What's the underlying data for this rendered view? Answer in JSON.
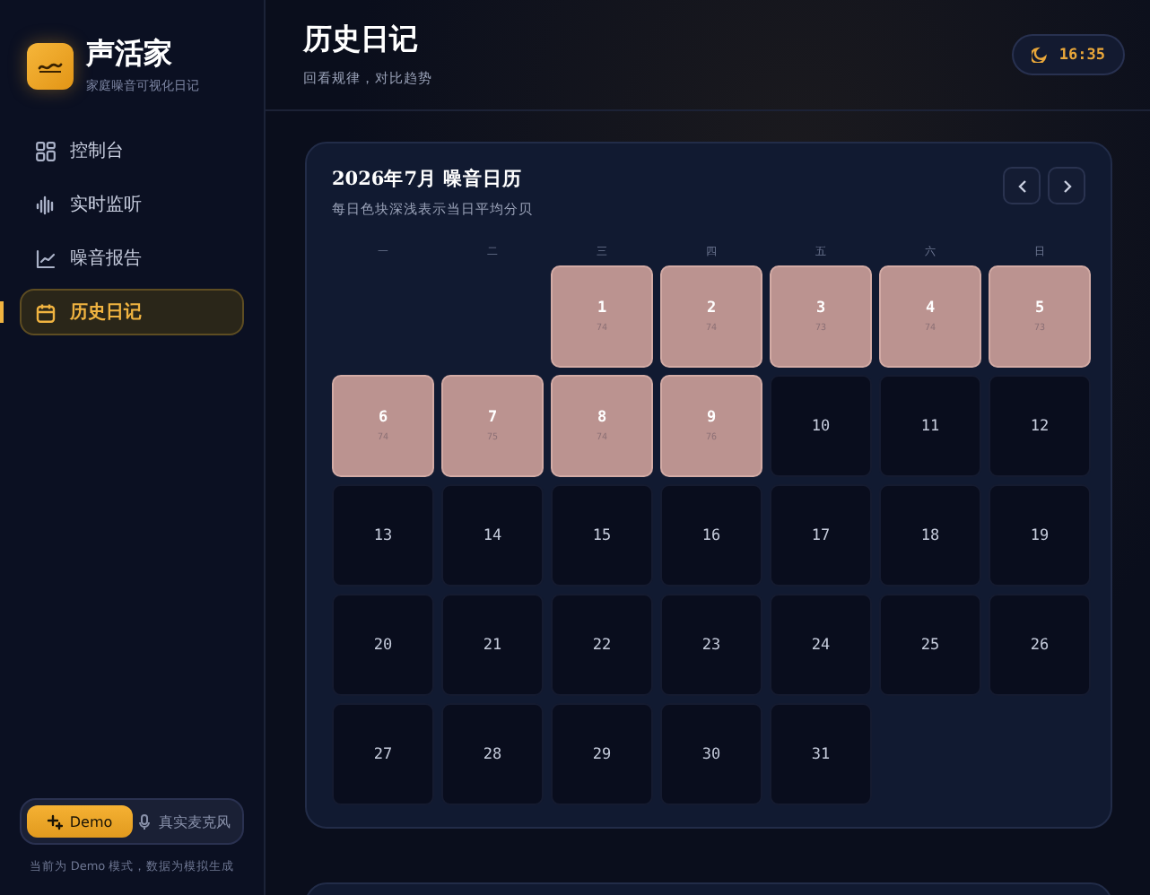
{
  "app": {
    "name": "声活家",
    "tagline": "家庭噪音可视化日记"
  },
  "nav": [
    {
      "label": "控制台",
      "selected": false
    },
    {
      "label": "实时监听",
      "selected": false
    },
    {
      "label": "噪音报告",
      "selected": false
    },
    {
      "label": "历史日记",
      "selected": true
    }
  ],
  "mode_switch": [
    {
      "label": "Demo",
      "selected": true
    },
    {
      "label": "真实麦克风",
      "selected": false
    }
  ],
  "mode_note": "当前为 Demo 模式，数据为模拟生成",
  "header": {
    "title": "历史日记",
    "subtitle": "回看规律，对比趋势",
    "clock": "16:35"
  },
  "calendar": {
    "title": "2026年7月 噪音日历",
    "subtitle": "每日色块深浅表示当日平均分贝",
    "weekdays": [
      "一",
      "二",
      "三",
      "四",
      "五",
      "六",
      "日"
    ],
    "days": [
      {
        "kind": "blank"
      },
      {
        "kind": "blank"
      },
      {
        "kind": "day",
        "day": "1",
        "value": "74",
        "has_data": true
      },
      {
        "kind": "day",
        "day": "2",
        "value": "74",
        "has_data": true
      },
      {
        "kind": "day",
        "day": "3",
        "value": "73",
        "has_data": true
      },
      {
        "kind": "day",
        "day": "4",
        "value": "74",
        "has_data": true
      },
      {
        "kind": "day",
        "day": "5",
        "value": "73",
        "has_data": true
      },
      {
        "kind": "day",
        "day": "6",
        "value": "74",
        "has_data": true
      },
      {
        "kind": "day",
        "day": "7",
        "value": "75",
        "has_data": true
      },
      {
        "kind": "day",
        "day": "8",
        "value": "74",
        "has_data": true
      },
      {
        "kind": "day",
        "day": "9",
        "value": "76",
        "has_data": true
      },
      {
        "kind": "day",
        "day": "10",
        "has_data": false
      },
      {
        "kind": "day",
        "day": "11",
        "has_data": false
      },
      {
        "kind": "day",
        "day": "12",
        "has_data": false
      },
      {
        "kind": "day",
        "day": "13",
        "has_data": false
      },
      {
        "kind": "day",
        "day": "14",
        "has_data": false
      },
      {
        "kind": "day",
        "day": "15",
        "has_data": false
      },
      {
        "kind": "day",
        "day": "16",
        "has_data": false
      },
      {
        "kind": "day",
        "day": "17",
        "has_data": false
      },
      {
        "kind": "day",
        "day": "18",
        "has_data": false
      },
      {
        "kind": "day",
        "day": "19",
        "has_data": false
      },
      {
        "kind": "day",
        "day": "20",
        "has_data": false
      },
      {
        "kind": "day",
        "day": "21",
        "has_data": false
      },
      {
        "kind": "day",
        "day": "22",
        "has_data": false
      },
      {
        "kind": "day",
        "day": "23",
        "has_data": false
      },
      {
        "kind": "day",
        "day": "24",
        "has_data": false
      },
      {
        "kind": "day",
        "day": "25",
        "has_data": false
      },
      {
        "kind": "day",
        "day": "26",
        "has_data": false
      },
      {
        "kind": "day",
        "day": "27",
        "has_data": false
      },
      {
        "kind": "day",
        "day": "28",
        "has_data": false
      },
      {
        "kind": "day",
        "day": "29",
        "has_data": false
      },
      {
        "kind": "day",
        "day": "30",
        "has_data": false
      },
      {
        "kind": "day",
        "day": "31",
        "has_data": false
      }
    ]
  }
}
